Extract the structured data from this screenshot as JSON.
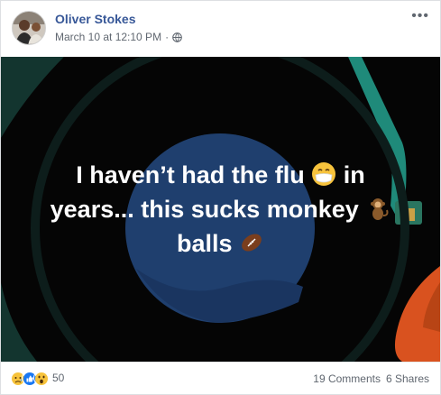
{
  "post": {
    "author": "Oliver Stokes",
    "timestamp": "March 10 at 12:10 PM",
    "separator": "·",
    "privacy_icon": "globe-icon",
    "more_label": "•••",
    "text_line1": "I haven’t had the flu",
    "text_line1_end": "in",
    "text_line2": "years... this sucks monkey",
    "text_line3": "balls",
    "emojis": [
      "mask-face-emoji",
      "monkey-emoji",
      "football-emoji"
    ]
  },
  "footer": {
    "reactions": [
      "sad-reaction-icon",
      "like-reaction-icon",
      "wow-reaction-icon"
    ],
    "reaction_count": "50",
    "comments": "19 Comments",
    "shares": "6 Shares"
  },
  "colors": {
    "author_link": "#385898",
    "meta_text": "#606770",
    "media_background": "#050505",
    "circle_navy": "#1f3f6e",
    "teal_accent": "#1f8a7a",
    "orange_accent": "#d9521f",
    "like_blue": "#1877f2",
    "reaction_yellow": "#f7c33c"
  }
}
